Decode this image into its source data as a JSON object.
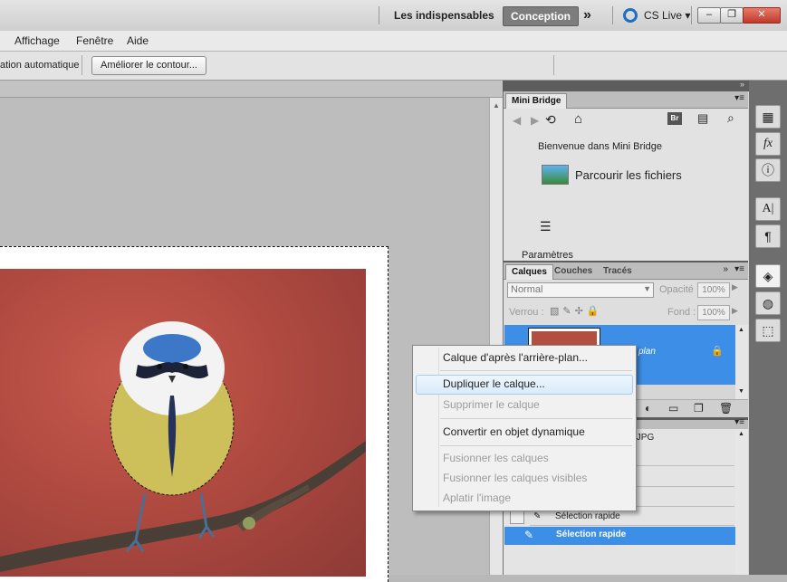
{
  "appbar": {
    "workspace_essentials": "Les indispensables",
    "workspace_design": "Conception",
    "more": "»",
    "cslive": "CS Live",
    "minimize": "–",
    "maximize": "❐",
    "close": "✕"
  },
  "menubar": [
    "Affichage",
    "Fenêtre",
    "Aide"
  ],
  "options": {
    "auto_enhance_partial": "ation automatique",
    "refine_edge": "Améliorer le contour..."
  },
  "minibridge": {
    "title": "Mini Bridge",
    "welcome": "Bienvenue dans Mini Bridge",
    "browse": "Parcourir les fichiers",
    "settings": "Paramètres",
    "br_label": "Br"
  },
  "layers_panel": {
    "tabs": [
      "Calques",
      "Couches",
      "Tracés"
    ],
    "blend_mode": "Normal",
    "opacity_label": "Opacité :",
    "opacity_value": "100%",
    "lock_label": "Verrou :",
    "fill_label": "Fond :",
    "fill_value": "100%",
    "layer_name_partial": "plan"
  },
  "history": {
    "file_partial": ".JPG",
    "items": [
      "Sélection rapide",
      "Sélection rapide"
    ]
  },
  "context_menu": {
    "items": [
      {
        "label": "Calque d'après l'arrière-plan...",
        "enabled": true
      },
      {
        "label": "Dupliquer le calque...",
        "enabled": true,
        "hovered": true
      },
      {
        "label": "Supprimer le calque",
        "enabled": false
      },
      {
        "label": "Convertir en objet dynamique",
        "enabled": true
      },
      {
        "label": "Fusionner les calques",
        "enabled": false
      },
      {
        "label": "Fusionner les calques visibles",
        "enabled": false
      },
      {
        "label": "Aplatir l'image",
        "enabled": false
      }
    ]
  },
  "colors": {
    "selection_blue": "#3d8ee6",
    "design_button": "#7d7d7d",
    "close_red": "#c0392b"
  }
}
